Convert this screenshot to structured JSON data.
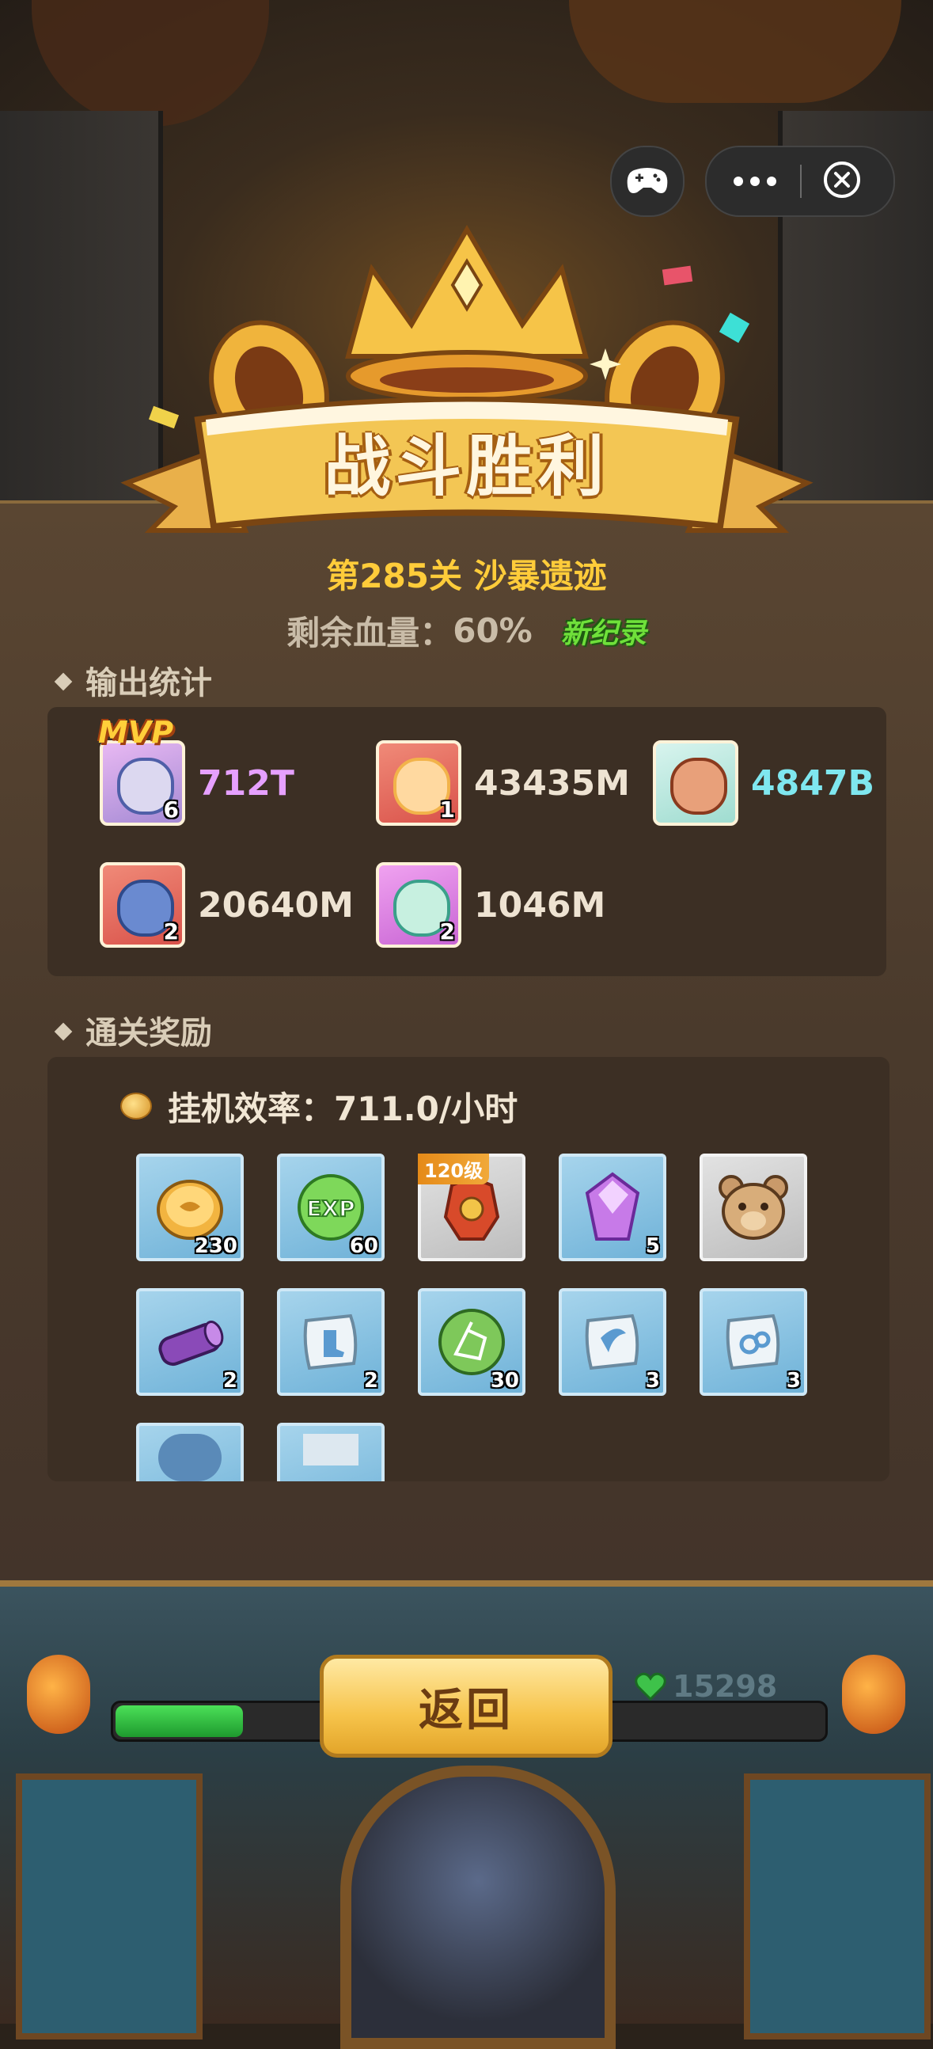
{
  "window": {
    "controls": {
      "game_icon": "gamepad-icon",
      "more_icon": "more-dots-icon",
      "close_icon": "close-circle-icon"
    }
  },
  "result": {
    "title": "战斗胜利",
    "stage": "第285关 沙暴遗迹",
    "hp_label": "剩余血量：",
    "hp_value": "60%",
    "new_record": "新纪录"
  },
  "damage_stats": {
    "header": "输出统计",
    "mvp_label": "MVP",
    "heroes": [
      {
        "level": "6",
        "damage": "712T",
        "color": "#e6a0ff",
        "bg": "#c9a2e0",
        "mvp": true
      },
      {
        "level": "1",
        "damage": "43435M",
        "color": "#eee3d2",
        "bg": "#e46a5a",
        "mvp": false
      },
      {
        "level": "",
        "damage": "4847B",
        "color": "#7fe7ef",
        "bg": "#b9ece4",
        "mvp": false
      },
      {
        "level": "2",
        "damage": "20640M",
        "color": "#eee3d2",
        "bg": "#e4685a",
        "mvp": false
      },
      {
        "level": "2",
        "damage": "1046M",
        "color": "#eee3d2",
        "bg": "#de7ee0",
        "mvp": false
      }
    ]
  },
  "rewards": {
    "header": "通关奖励",
    "rate": "挂机效率：711.0/小时",
    "items": [
      {
        "name": "gold-coin-icon",
        "qty": "230",
        "style": "blue"
      },
      {
        "name": "exp-orb-icon",
        "qty": "60",
        "style": "blue"
      },
      {
        "name": "armor-icon",
        "qty": "",
        "style": "grey",
        "tag": "120级"
      },
      {
        "name": "purple-crystal-icon",
        "qty": "5",
        "style": "blue"
      },
      {
        "name": "bear-mask-icon",
        "qty": "",
        "style": "grey"
      },
      {
        "name": "purple-log-icon",
        "qty": "2",
        "style": "blue"
      },
      {
        "name": "scroll-boot-icon",
        "qty": "2",
        "style": "blue"
      },
      {
        "name": "constellation-icon",
        "qty": "30",
        "style": "blue"
      },
      {
        "name": "scroll-horn-icon",
        "qty": "3",
        "style": "blue"
      },
      {
        "name": "scroll-swirl-icon",
        "qty": "3",
        "style": "blue"
      },
      {
        "name": "partial-item-icon",
        "qty": "",
        "style": "blue"
      },
      {
        "name": "partial-item-icon",
        "qty": "",
        "style": "blue"
      }
    ]
  },
  "hud": {
    "hp_value": "15298",
    "hp_fill_fraction": 0.18,
    "back_label": "返回"
  }
}
